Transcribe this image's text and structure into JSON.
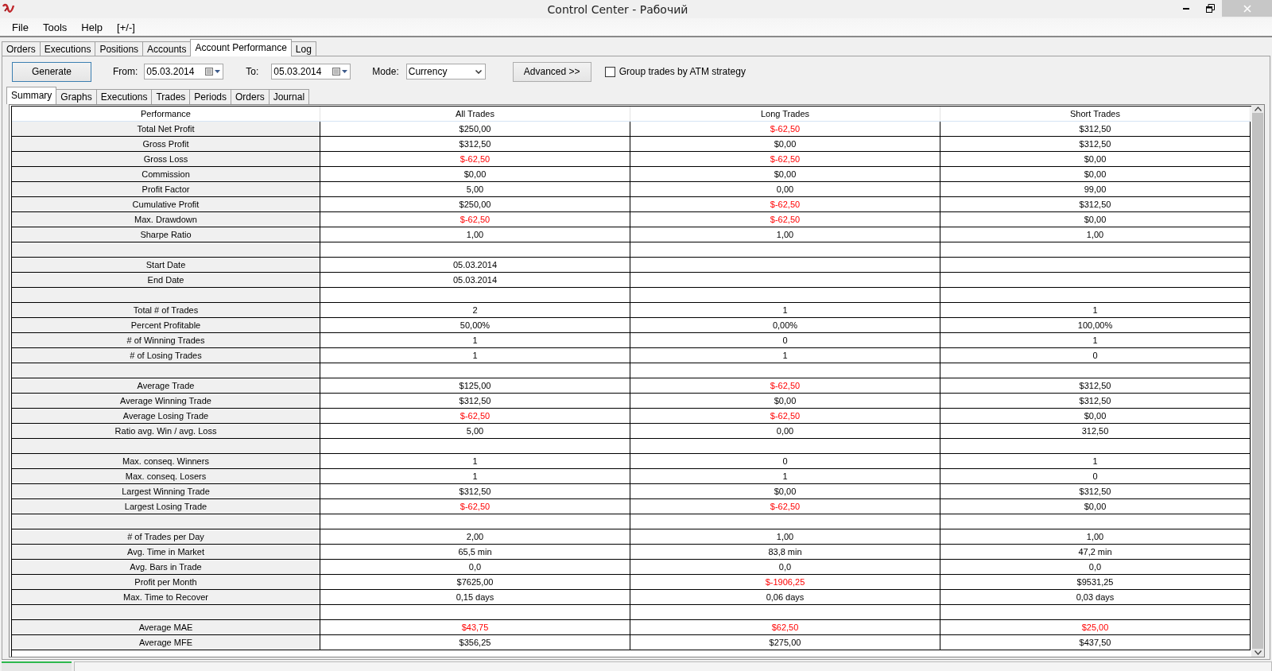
{
  "window": {
    "title": "Control Center - Рабочий"
  },
  "menu": [
    "File",
    "Tools",
    "Help",
    "[+/-]"
  ],
  "tabs": [
    {
      "label": "Orders",
      "selected": false
    },
    {
      "label": "Executions",
      "selected": false
    },
    {
      "label": "Positions",
      "selected": false
    },
    {
      "label": "Accounts",
      "selected": false
    },
    {
      "label": "Account Performance",
      "selected": true
    },
    {
      "label": "Log",
      "selected": false
    }
  ],
  "toolbar": {
    "generate": "Generate",
    "from_label": "From:",
    "from_value": "05.03.2014",
    "to_label": "To:",
    "to_value": "05.03.2014",
    "mode_label": "Mode:",
    "mode_value": "Currency",
    "advanced": "Advanced >>",
    "group_by_atm": {
      "label": "Group trades by ATM strategy",
      "checked": false
    }
  },
  "subtabs": [
    {
      "label": "Summary",
      "selected": true
    },
    {
      "label": "Graphs",
      "selected": false
    },
    {
      "label": "Executions",
      "selected": false
    },
    {
      "label": "Trades",
      "selected": false
    },
    {
      "label": "Periods",
      "selected": false
    },
    {
      "label": "Orders",
      "selected": false
    },
    {
      "label": "Journal",
      "selected": false
    }
  ],
  "table": {
    "columns": [
      "Performance",
      "All Trades",
      "Long Trades",
      "Short Trades"
    ],
    "sections": [
      {
        "rows": [
          {
            "label": "Total Net Profit",
            "cells": [
              {
                "text": "$250,00",
                "negative": false
              },
              {
                "text": "$-62,50",
                "negative": true
              },
              {
                "text": "$312,50",
                "negative": false
              }
            ]
          },
          {
            "label": "Gross Profit",
            "cells": [
              {
                "text": "$312,50",
                "negative": false
              },
              {
                "text": "$0,00",
                "negative": false
              },
              {
                "text": "$312,50",
                "negative": false
              }
            ]
          },
          {
            "label": "Gross Loss",
            "cells": [
              {
                "text": "$-62,50",
                "negative": true
              },
              {
                "text": "$-62,50",
                "negative": true
              },
              {
                "text": "$0,00",
                "negative": false
              }
            ]
          },
          {
            "label": "Commission",
            "cells": [
              {
                "text": "$0,00",
                "negative": false
              },
              {
                "text": "$0,00",
                "negative": false
              },
              {
                "text": "$0,00",
                "negative": false
              }
            ]
          },
          {
            "label": "Profit Factor",
            "cells": [
              {
                "text": "5,00",
                "negative": false
              },
              {
                "text": "0,00",
                "negative": false
              },
              {
                "text": "99,00",
                "negative": false
              }
            ]
          },
          {
            "label": "Cumulative Profit",
            "cells": [
              {
                "text": "$250,00",
                "negative": false
              },
              {
                "text": "$-62,50",
                "negative": true
              },
              {
                "text": "$312,50",
                "negative": false
              }
            ]
          },
          {
            "label": "Max. Drawdown",
            "cells": [
              {
                "text": "$-62,50",
                "negative": true
              },
              {
                "text": "$-62,50",
                "negative": true
              },
              {
                "text": "$0,00",
                "negative": false
              }
            ]
          },
          {
            "label": "Sharpe Ratio",
            "cells": [
              {
                "text": "1,00",
                "negative": false
              },
              {
                "text": "1,00",
                "negative": false
              },
              {
                "text": "1,00",
                "negative": false
              }
            ]
          }
        ]
      },
      {
        "rows": [
          {
            "label": "Start Date",
            "cells": [
              {
                "text": "05.03.2014",
                "negative": false
              }
            ]
          },
          {
            "label": "End Date",
            "cells": [
              {
                "text": "05.03.2014",
                "negative": false
              }
            ]
          }
        ]
      },
      {
        "rows": [
          {
            "label": "Total # of Trades",
            "cells": [
              {
                "text": "2",
                "negative": false
              },
              {
                "text": "1",
                "negative": false
              },
              {
                "text": "1",
                "negative": false
              }
            ]
          },
          {
            "label": "Percent Profitable",
            "cells": [
              {
                "text": "50,00%",
                "negative": false
              },
              {
                "text": "0,00%",
                "negative": false
              },
              {
                "text": "100,00%",
                "negative": false
              }
            ]
          },
          {
            "label": "# of Winning Trades",
            "cells": [
              {
                "text": "1",
                "negative": false
              },
              {
                "text": "0",
                "negative": false
              },
              {
                "text": "1",
                "negative": false
              }
            ]
          },
          {
            "label": "# of Losing Trades",
            "cells": [
              {
                "text": "1",
                "negative": false
              },
              {
                "text": "1",
                "negative": false
              },
              {
                "text": "0",
                "negative": false
              }
            ]
          }
        ]
      },
      {
        "rows": [
          {
            "label": "Average Trade",
            "cells": [
              {
                "text": "$125,00",
                "negative": false
              },
              {
                "text": "$-62,50",
                "negative": true
              },
              {
                "text": "$312,50",
                "negative": false
              }
            ]
          },
          {
            "label": "Average Winning Trade",
            "cells": [
              {
                "text": "$312,50",
                "negative": false
              },
              {
                "text": "$0,00",
                "negative": false
              },
              {
                "text": "$312,50",
                "negative": false
              }
            ]
          },
          {
            "label": "Average Losing Trade",
            "cells": [
              {
                "text": "$-62,50",
                "negative": true
              },
              {
                "text": "$-62,50",
                "negative": true
              },
              {
                "text": "$0,00",
                "negative": false
              }
            ]
          },
          {
            "label": "Ratio avg. Win / avg. Loss",
            "cells": [
              {
                "text": "5,00",
                "negative": false
              },
              {
                "text": "0,00",
                "negative": false
              },
              {
                "text": "312,50",
                "negative": false
              }
            ]
          }
        ]
      },
      {
        "rows": [
          {
            "label": "Max. conseq. Winners",
            "cells": [
              {
                "text": "1",
                "negative": false
              },
              {
                "text": "0",
                "negative": false
              },
              {
                "text": "1",
                "negative": false
              }
            ]
          },
          {
            "label": "Max. conseq. Losers",
            "cells": [
              {
                "text": "1",
                "negative": false
              },
              {
                "text": "1",
                "negative": false
              },
              {
                "text": "0",
                "negative": false
              }
            ]
          },
          {
            "label": "Largest Winning Trade",
            "cells": [
              {
                "text": "$312,50",
                "negative": false
              },
              {
                "text": "$0,00",
                "negative": false
              },
              {
                "text": "$312,50",
                "negative": false
              }
            ]
          },
          {
            "label": "Largest Losing Trade",
            "cells": [
              {
                "text": "$-62,50",
                "negative": true
              },
              {
                "text": "$-62,50",
                "negative": true
              },
              {
                "text": "$0,00",
                "negative": false
              }
            ]
          }
        ]
      },
      {
        "rows": [
          {
            "label": "# of Trades per Day",
            "cells": [
              {
                "text": "2,00",
                "negative": false
              },
              {
                "text": "1,00",
                "negative": false
              },
              {
                "text": "1,00",
                "negative": false
              }
            ]
          },
          {
            "label": "Avg. Time in Market",
            "cells": [
              {
                "text": "65,5 min",
                "negative": false
              },
              {
                "text": "83,8 min",
                "negative": false
              },
              {
                "text": "47,2 min",
                "negative": false
              }
            ]
          },
          {
            "label": "Avg. Bars in Trade",
            "cells": [
              {
                "text": "0,0",
                "negative": false
              },
              {
                "text": "0,0",
                "negative": false
              },
              {
                "text": "0,0",
                "negative": false
              }
            ]
          },
          {
            "label": "Profit per Month",
            "cells": [
              {
                "text": "$7625,00",
                "negative": false
              },
              {
                "text": "$-1906,25",
                "negative": true
              },
              {
                "text": "$9531,25",
                "negative": false
              }
            ]
          },
          {
            "label": "Max. Time to Recover",
            "cells": [
              {
                "text": "0,15 days",
                "negative": false
              },
              {
                "text": "0,06 days",
                "negative": false
              },
              {
                "text": "0,03 days",
                "negative": false
              }
            ]
          }
        ]
      },
      {
        "rows": [
          {
            "label": "Average MAE",
            "cells": [
              {
                "text": "$43,75",
                "negative": true
              },
              {
                "text": "$62,50",
                "negative": true
              },
              {
                "text": "$25,00",
                "negative": true
              }
            ]
          },
          {
            "label": "Average MFE",
            "cells": [
              {
                "text": "$356,25",
                "negative": false
              },
              {
                "text": "$275,00",
                "negative": false
              },
              {
                "text": "$437,50",
                "negative": false
              }
            ]
          }
        ]
      }
    ]
  }
}
